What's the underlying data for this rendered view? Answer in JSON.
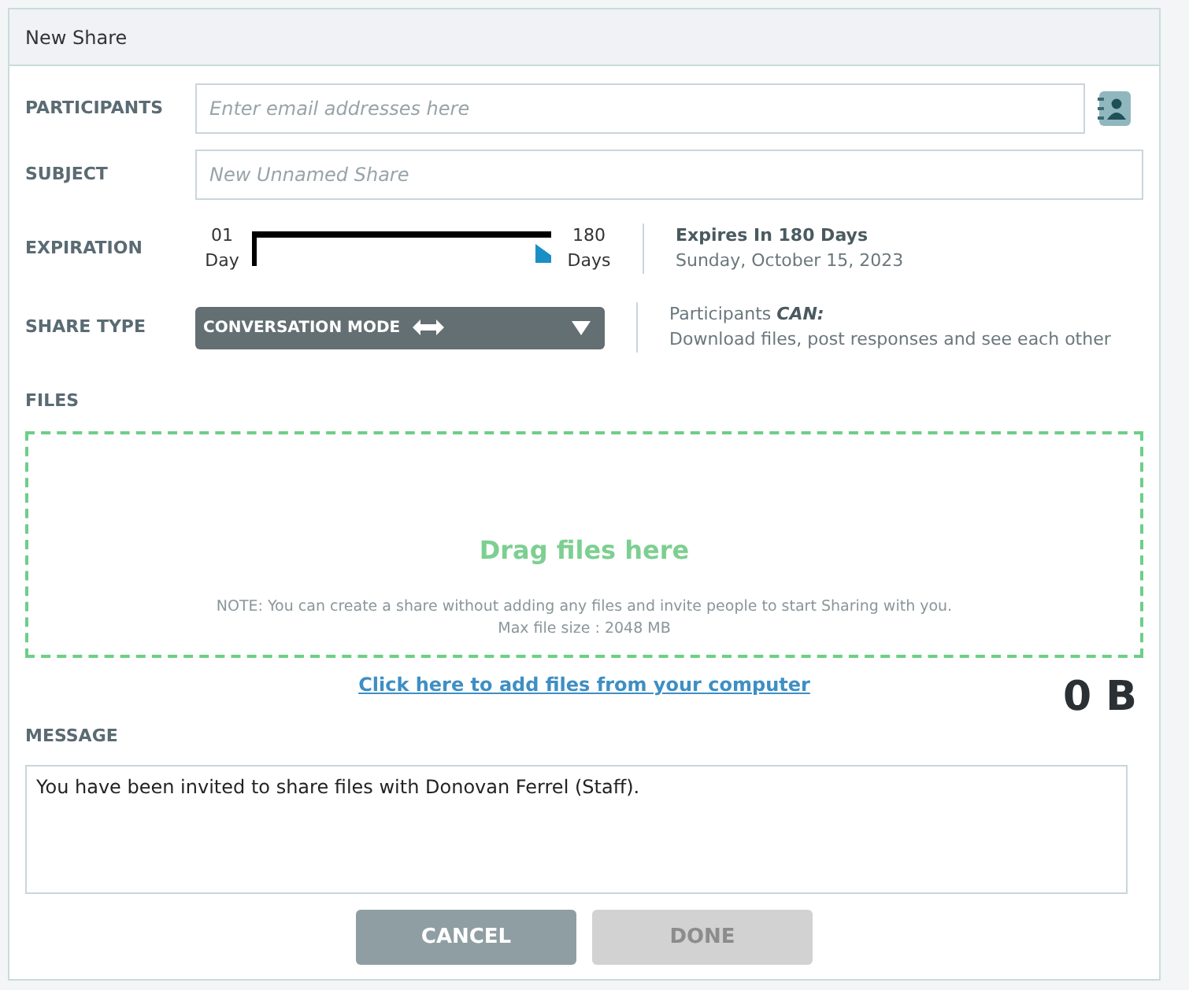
{
  "dialog": {
    "title": "New Share"
  },
  "participants": {
    "label": "PARTICIPANTS",
    "placeholder": "Enter email addresses here"
  },
  "subject": {
    "label": "SUBJECT",
    "placeholder": "New Unnamed Share"
  },
  "expiration": {
    "label": "EXPIRATION",
    "min_number": "01",
    "min_unit": "Day",
    "max_number": "180",
    "max_unit": "Days",
    "level": 1,
    "headline": "Expires In 180 Days",
    "date": "Sunday, October 15, 2023"
  },
  "share_type": {
    "label": "SHARE TYPE",
    "value": "CONVERSATION MODE",
    "info_prefix": "Participants ",
    "info_emphasis": "CAN:",
    "info": "Download files, post responses and see each other"
  },
  "files": {
    "label": "FILES",
    "drop_title": "Drag files here",
    "note": "NOTE: You can create a share without adding any files and invite people to start Sharing with you.",
    "max_size": "Max file size : 2048 MB",
    "add_link": "Click here to add files from your computer",
    "total": "0 B"
  },
  "message": {
    "label": "MESSAGE",
    "value": "You have been invited to share files with Donovan Ferrel (Staff)."
  },
  "buttons": [
    {
      "label": "CANCEL",
      "disabled": false
    },
    {
      "label": "DONE",
      "disabled": true
    }
  ]
}
